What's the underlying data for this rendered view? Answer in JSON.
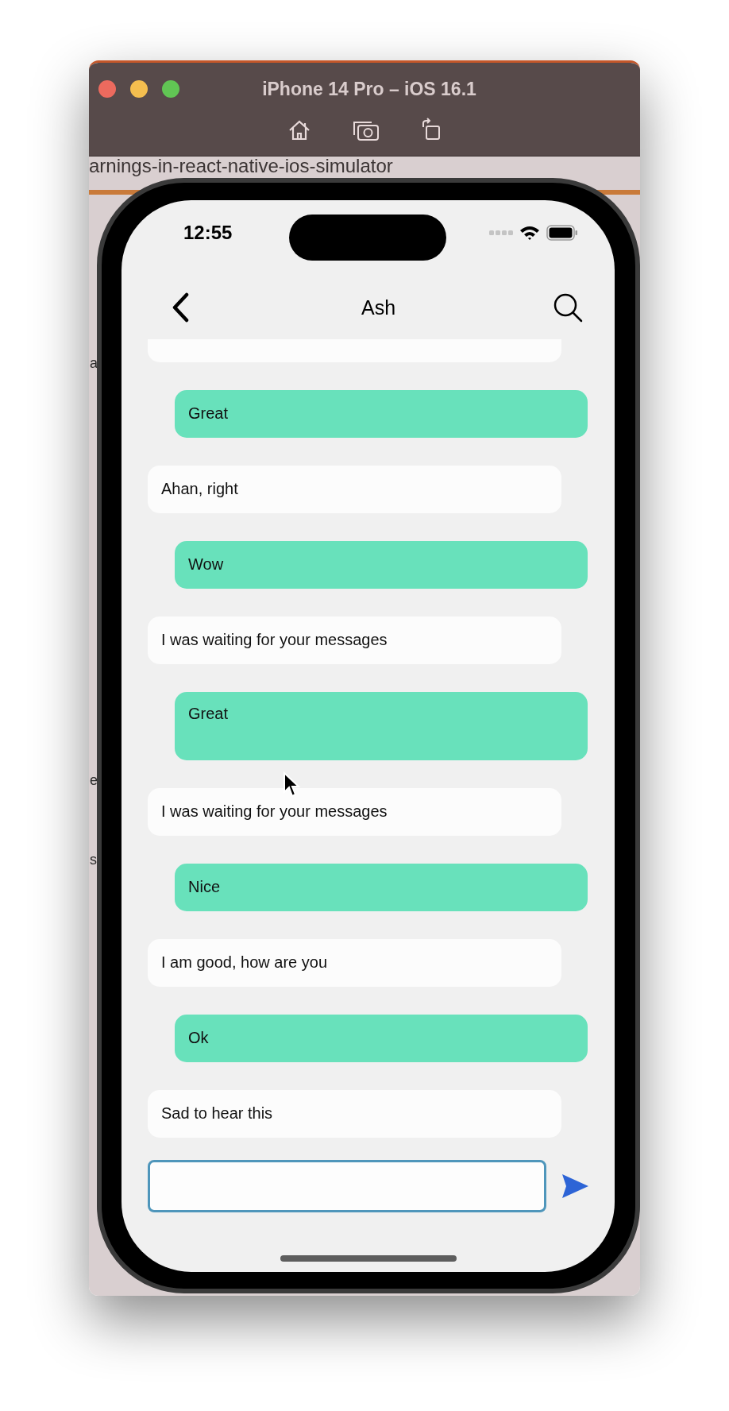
{
  "window": {
    "title": "iPhone 14 Pro – iOS 16.1"
  },
  "background_page": {
    "url_text": "arnings-in-react-native-ios-simulator",
    "edge_fragments": [
      "a",
      "e",
      "s"
    ]
  },
  "status_bar": {
    "time": "12:55"
  },
  "header": {
    "title": "Ash"
  },
  "messages": [
    {
      "kind": "outgoing",
      "text": "Great",
      "tall": false
    },
    {
      "kind": "incoming",
      "text": "Ahan, right",
      "tall": false
    },
    {
      "kind": "outgoing",
      "text": "Wow",
      "tall": false
    },
    {
      "kind": "incoming",
      "text": "I was waiting for your messages",
      "tall": false
    },
    {
      "kind": "outgoing",
      "text": "Great",
      "tall": true
    },
    {
      "kind": "incoming",
      "text": "I was waiting for your messages",
      "tall": false
    },
    {
      "kind": "outgoing",
      "text": "Nice",
      "tall": false
    },
    {
      "kind": "incoming",
      "text": "I am good, how are you",
      "tall": false
    },
    {
      "kind": "outgoing",
      "text": "Ok",
      "tall": false
    },
    {
      "kind": "incoming",
      "text": "Sad to hear this",
      "tall": false
    }
  ]
}
